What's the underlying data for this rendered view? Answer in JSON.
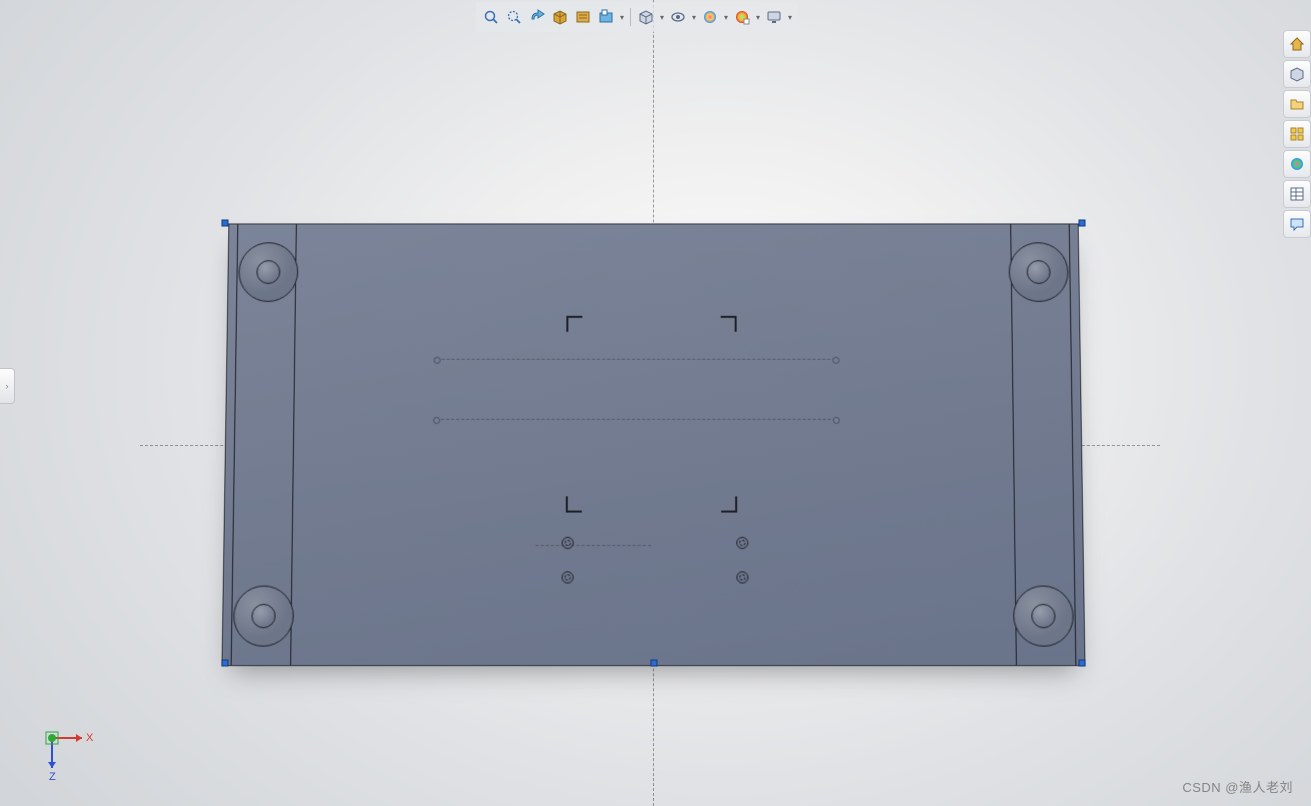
{
  "triad": {
    "x_label": "X",
    "z_label": "Z",
    "x_color": "#d43a2f",
    "y_color": "#2fa836",
    "z_color": "#2f4fd4"
  },
  "watermark": "CSDN @渔人老刘",
  "hud": {
    "items": [
      {
        "name": "zoom-to-fit-icon",
        "title": "Zoom to Fit"
      },
      {
        "name": "zoom-area-icon",
        "title": "Zoom to Area"
      },
      {
        "name": "previous-view-icon",
        "title": "Previous View"
      },
      {
        "name": "section-view-icon",
        "title": "Section View"
      },
      {
        "name": "dynamic-annotation-icon",
        "title": "Dynamic Annotation Views"
      },
      {
        "name": "view-settings-icon",
        "title": "View Orientation"
      }
    ],
    "groups": [
      {
        "name": "display-style-icon",
        "title": "Display Style"
      },
      {
        "name": "hide-show-icon",
        "title": "Hide/Show Items"
      },
      {
        "name": "edit-appearance-icon",
        "title": "Edit Appearance"
      },
      {
        "name": "apply-scene-icon",
        "title": "Apply Scene"
      },
      {
        "name": "view-screen-icon",
        "title": "View Settings"
      }
    ]
  },
  "right_pane": [
    {
      "name": "home-icon",
      "title": "SOLIDWORKS Resources"
    },
    {
      "name": "design-library-icon",
      "title": "Design Library"
    },
    {
      "name": "file-explorer-icon",
      "title": "File Explorer"
    },
    {
      "name": "view-palette-icon",
      "title": "View Palette"
    },
    {
      "name": "appearances-icon",
      "title": "Appearances, Scenes, and Decals"
    },
    {
      "name": "custom-props-icon",
      "title": "Custom Properties"
    },
    {
      "name": "forum-icon",
      "title": "SOLIDWORKS Forum"
    }
  ],
  "flyout": {
    "glyph": "›"
  }
}
